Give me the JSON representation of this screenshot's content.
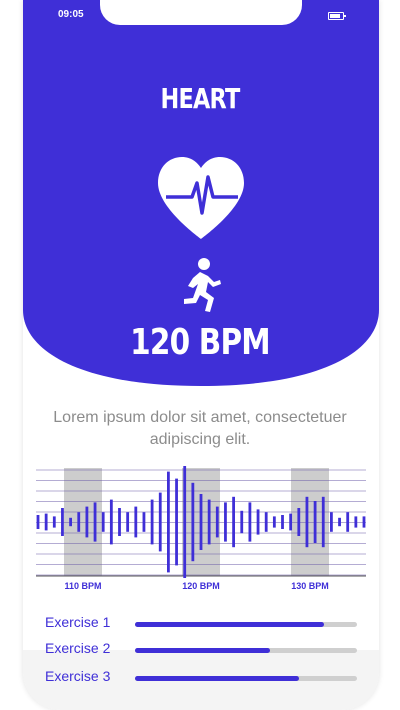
{
  "status_bar": {
    "time": "09:05"
  },
  "header": {
    "title": "HEART",
    "bpm": "120 BPM"
  },
  "description": "Lorem ipsum dolor sit amet, consectetuer adipiscing elit.",
  "chart_data": {
    "type": "bar",
    "x_labels": [
      "110 BPM",
      "120 BPM",
      "130 BPM"
    ],
    "values": [
      0.25,
      0.3,
      0.2,
      0.5,
      0.15,
      0.35,
      0.55,
      0.7,
      0.35,
      0.8,
      0.5,
      0.35,
      0.55,
      0.35,
      0.8,
      1.05,
      1.8,
      1.55,
      2.0,
      1.4,
      1.0,
      0.8,
      0.55,
      0.7,
      0.9,
      0.4,
      0.7,
      0.45,
      0.35,
      0.2,
      0.25,
      0.3,
      0.5,
      0.9,
      0.75,
      0.9,
      0.35,
      0.15,
      0.35,
      0.2,
      0.2
    ]
  },
  "exercises": [
    {
      "label": "Exercise 1",
      "progress": 0.85
    },
    {
      "label": "Exercise 2",
      "progress": 0.61
    },
    {
      "label": "Exercise 3",
      "progress": 0.74
    }
  ],
  "colors": {
    "accent": "#3f2fd7",
    "track": "#cfcfcf",
    "text_muted": "#8c8c8c"
  }
}
